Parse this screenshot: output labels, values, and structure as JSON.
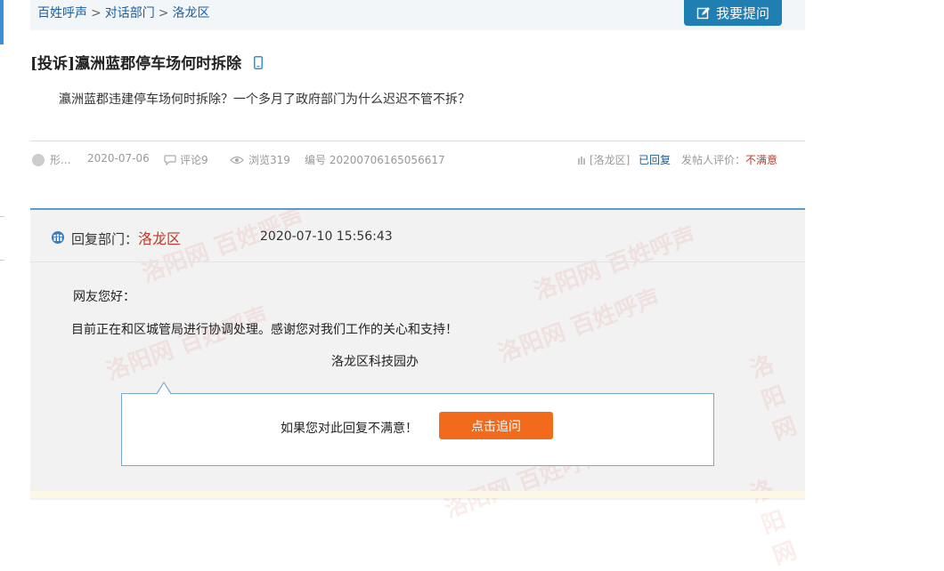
{
  "breadcrumb": {
    "root": "百姓呼声",
    "section": "对话部门",
    "current": "洛龙区",
    "separator": ">"
  },
  "ask_button": {
    "label": "我要提问",
    "icon": "edit-icon"
  },
  "post": {
    "title": "[投诉]瀛洲蓝郡停车场何时拆除",
    "body": "瀛洲蓝郡违建停车场何时拆除？一个多月了政府部门为什么迟迟不管不拆？"
  },
  "meta": {
    "author": "形...",
    "date": "2020-07-06",
    "comments": "评论9",
    "views": "浏览319",
    "number": "编号 20200706165056617",
    "district": "[洛龙区]",
    "status": "已回复",
    "rating_label": "发帖人评价：",
    "rating_value": "不满意"
  },
  "reply": {
    "dept_label": "回复部门：",
    "dept_name": "洛龙区",
    "time": "2020-07-10 15:56:43",
    "greeting": "网友您好：",
    "content": "目前正在和区城管局进行协调处理。感谢您对我们工作的关心和支持！",
    "signature": "洛龙区科技园办"
  },
  "followup": {
    "text": "如果您对此回复不满意！",
    "button": "点击追问"
  },
  "colors": {
    "accent_blue": "#1f7fb3",
    "link_blue": "#1a5e9e",
    "orange_button": "#f26a1b",
    "dept_red": "#c0392b"
  }
}
